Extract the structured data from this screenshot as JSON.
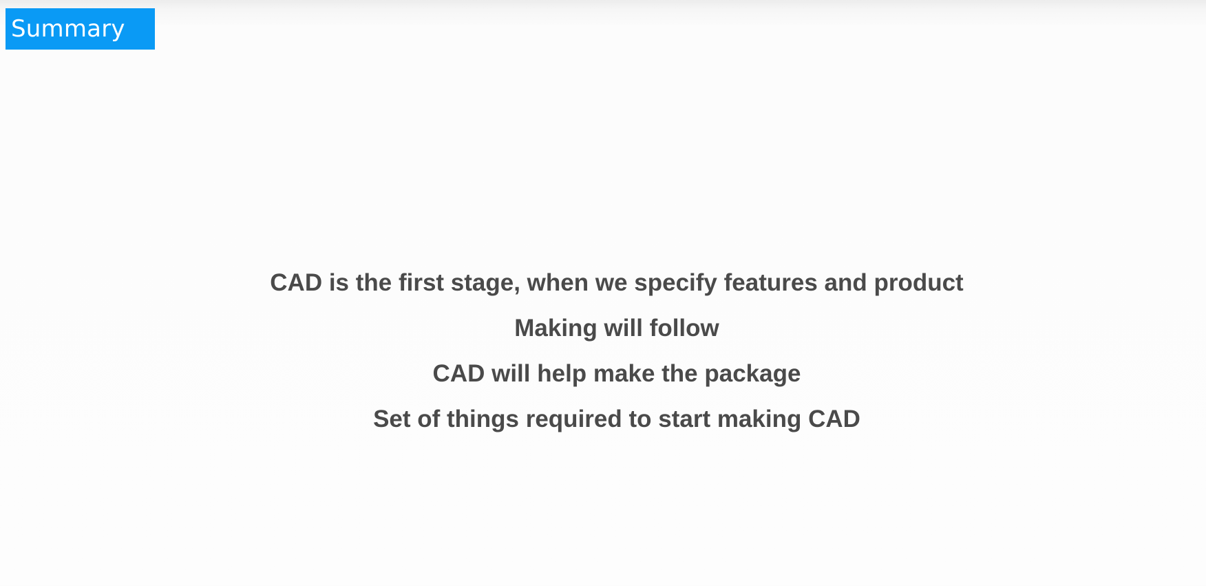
{
  "slide": {
    "section_title": "Summary",
    "lines": [
      "CAD is the first stage, when we specify features and product",
      "Making will follow",
      "CAD will help make the package",
      "Set of things required to start making CAD"
    ]
  },
  "colors": {
    "accent": "#0a9af5",
    "text": "#4a4a4a",
    "background": "#fdfdfd"
  }
}
